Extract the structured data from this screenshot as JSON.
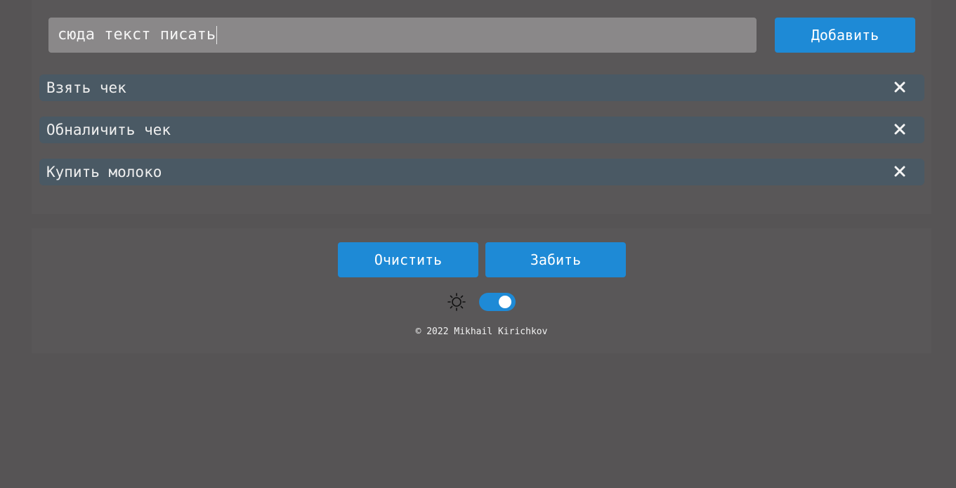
{
  "input": {
    "value": "сюда текст писать"
  },
  "add_button": {
    "label": "Добавить"
  },
  "todos": [
    {
      "label": "Взять чек",
      "delete_icon": "close-icon"
    },
    {
      "label": "Обналичить чек",
      "delete_icon": "close-icon"
    },
    {
      "label": "Купить молоко",
      "delete_icon": "close-icon"
    }
  ],
  "actions": {
    "clear_label": "Очистить",
    "nail_label": "Забить"
  },
  "theme": {
    "icon": "sun-icon",
    "toggle_on": true
  },
  "footer": {
    "copyright": "© 2022 Mikhail Kirichkov"
  },
  "colors": {
    "accent": "#1e8ad6",
    "background": "#565455",
    "item_background": "#4a5964",
    "input_background": "#8a8889"
  }
}
